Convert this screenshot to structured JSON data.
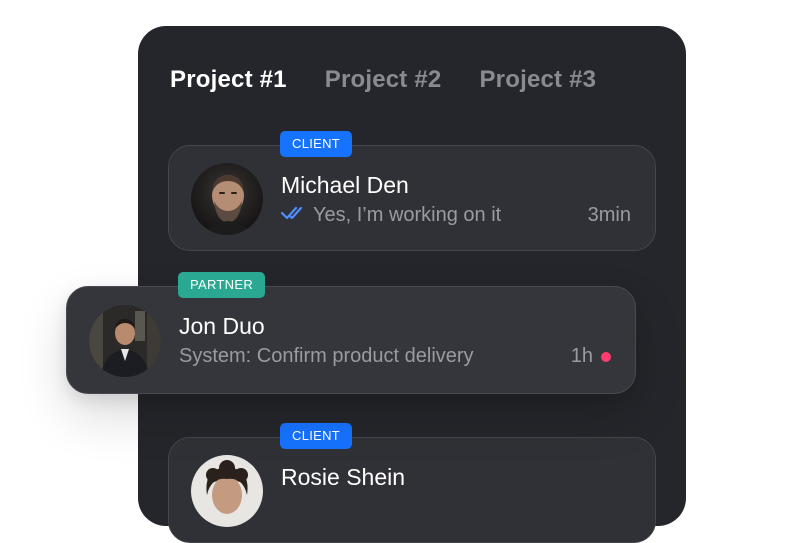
{
  "tabs": [
    {
      "label": "Project #1",
      "active": true
    },
    {
      "label": "Project #2",
      "active": false
    },
    {
      "label": "Project #3",
      "active": false
    }
  ],
  "conversations": [
    {
      "badge": "CLIENT",
      "name": "Michael Den",
      "message": "Yes, I’m working on it",
      "time": "3min",
      "read_receipt": "double-check-icon"
    },
    {
      "badge": "PARTNER",
      "name": "Jon Duo",
      "message": "System: Confirm product delivery",
      "time": "1h",
      "unread_indicator": "unread-dot"
    },
    {
      "badge": "CLIENT",
      "name": "Rosie Shein"
    }
  ],
  "colors": {
    "panel": "#25262b",
    "client_badge": "#1673ff",
    "partner_badge": "#2aa891",
    "read_check": "#4d8dff",
    "unread_dot": "#ff3d6e"
  }
}
